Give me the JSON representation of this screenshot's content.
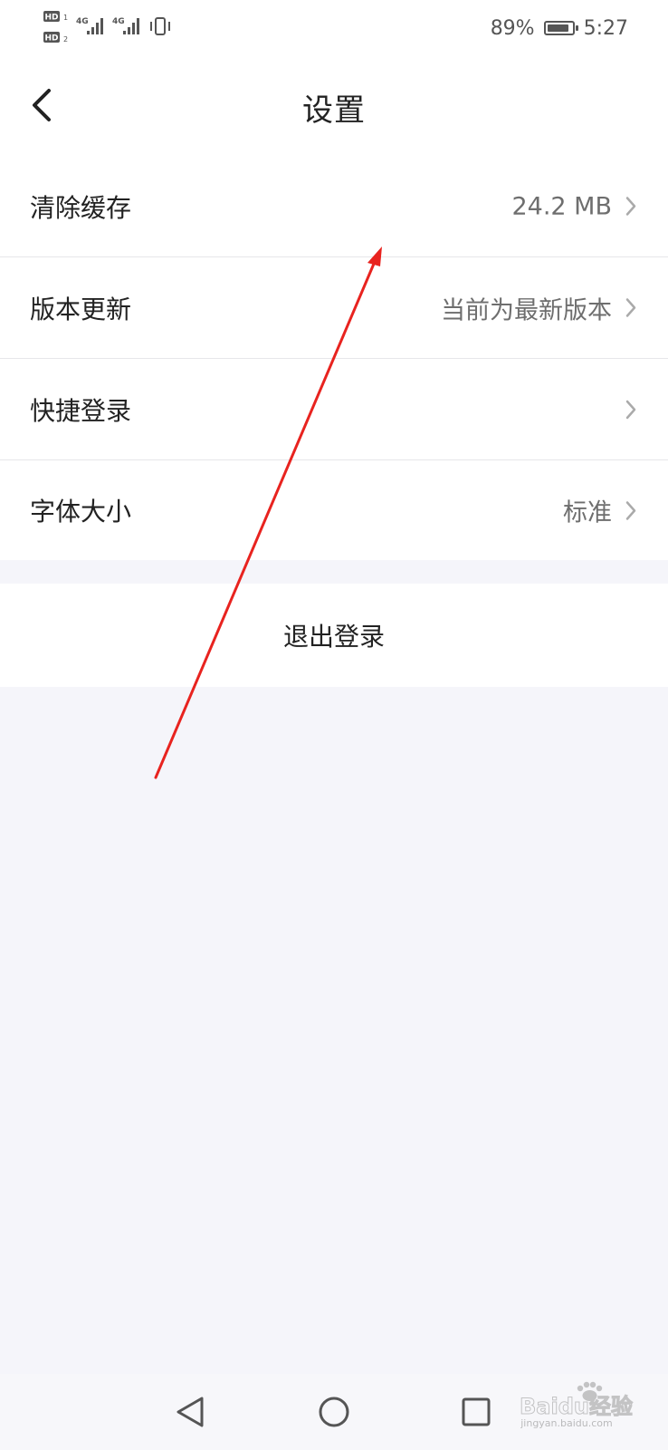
{
  "status_bar": {
    "network_label_1": "HD",
    "network_label_2": "HD",
    "sim_1": "1",
    "sim_2": "2",
    "network_type_1": "4G",
    "network_type_2": "4G",
    "battery_percent": "89%",
    "battery_level": 0.89,
    "time": "5:27"
  },
  "header": {
    "title": "设置",
    "back_icon": "chevron-left-icon"
  },
  "settings": {
    "items": [
      {
        "label": "清除缓存",
        "value": "24.2 MB"
      },
      {
        "label": "版本更新",
        "value": "当前为最新版本"
      },
      {
        "label": "快捷登录",
        "value": ""
      },
      {
        "label": "字体大小",
        "value": "标准"
      }
    ]
  },
  "logout": {
    "label": "退出登录"
  },
  "nav_bar": {
    "back_icon": "triangle-back-icon",
    "home_icon": "circle-home-icon",
    "recents_icon": "square-recents-icon"
  },
  "watermark": {
    "brand": "Baidu经验",
    "url": "jingyan.baidu.com"
  },
  "colors": {
    "annotation_arrow": "#e8231f",
    "page_background": "#f5f5fa",
    "text_primary": "#222222",
    "text_secondary": "#6e6e6e"
  }
}
